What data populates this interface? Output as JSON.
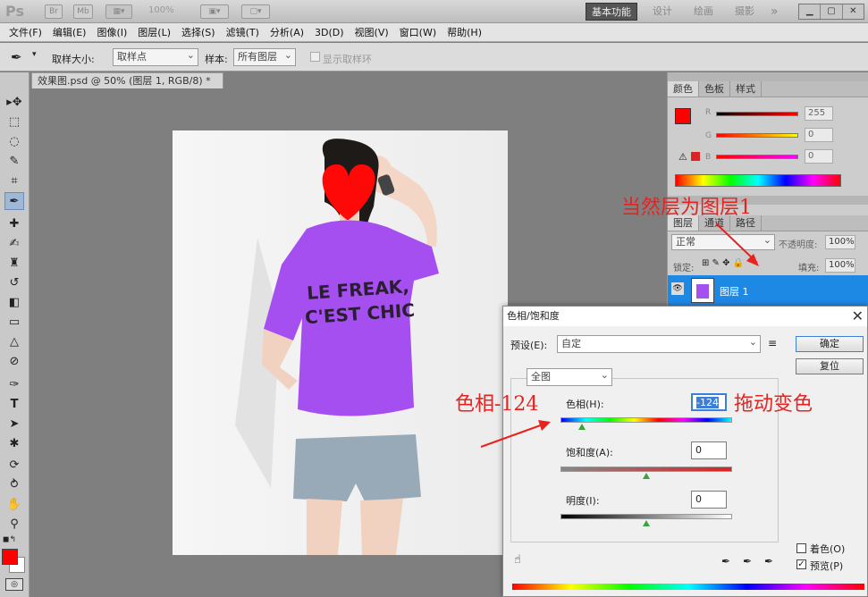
{
  "titlebar": {
    "logo": "Ps",
    "br": "Br",
    "mb": "Mb",
    "zoom": "100%",
    "workspaces": [
      "基本功能",
      "设计",
      "绘画",
      "摄影"
    ],
    "more": "»"
  },
  "menubar": {
    "items": [
      "文件(F)",
      "编辑(E)",
      "图像(I)",
      "图层(L)",
      "选择(S)",
      "滤镜(T)",
      "分析(A)",
      "3D(D)",
      "视图(V)",
      "窗口(W)",
      "帮助(H)"
    ]
  },
  "options": {
    "sample_size_label": "取样大小:",
    "sample_size_value": "取样点",
    "sample_label": "样本:",
    "sample_value": "所有图层",
    "show_ring": "显示取样环"
  },
  "document": {
    "tab_title": "效果图.psd @ 50% (图层 1, RGB/8) *"
  },
  "photo": {
    "shirt_text_line1": "LE FREAK,",
    "shirt_text_line2": "C'EST CHIC"
  },
  "colors": {
    "foreground": "#ff0000",
    "background": "#ffffff",
    "shirt": "#a64ff0",
    "accent": "#1e88e5",
    "annotation": "#e8221f"
  },
  "color_panel": {
    "tabs": [
      "颜色",
      "色板",
      "样式"
    ],
    "r_label": "R",
    "g_label": "G",
    "b_label": "B",
    "r_value": "255",
    "g_value": "0",
    "b_value": "0"
  },
  "layers_panel": {
    "tabs": [
      "图层",
      "通道",
      "路径"
    ],
    "blend_mode": "正常",
    "opacity_label": "不透明度:",
    "opacity_value": "100%",
    "lock_label": "锁定:",
    "fill_label": "填充:",
    "fill_value": "100%",
    "layer_name": "图层 1"
  },
  "dialog": {
    "title": "色相/饱和度",
    "preset_label": "预设(E):",
    "preset_value": "自定",
    "ok": "确定",
    "reset": "复位",
    "channel": "全图",
    "hue_label": "色相(H):",
    "hue_value": "-124",
    "saturation_label": "饱和度(A):",
    "saturation_value": "0",
    "lightness_label": "明度(I):",
    "lightness_value": "0",
    "colorize": "着色(O)",
    "preview": "预览(P)"
  },
  "annotations": {
    "layer_note": "当然层为图层1",
    "hue_note": "色相-124",
    "drag_note": "拖动变色"
  }
}
